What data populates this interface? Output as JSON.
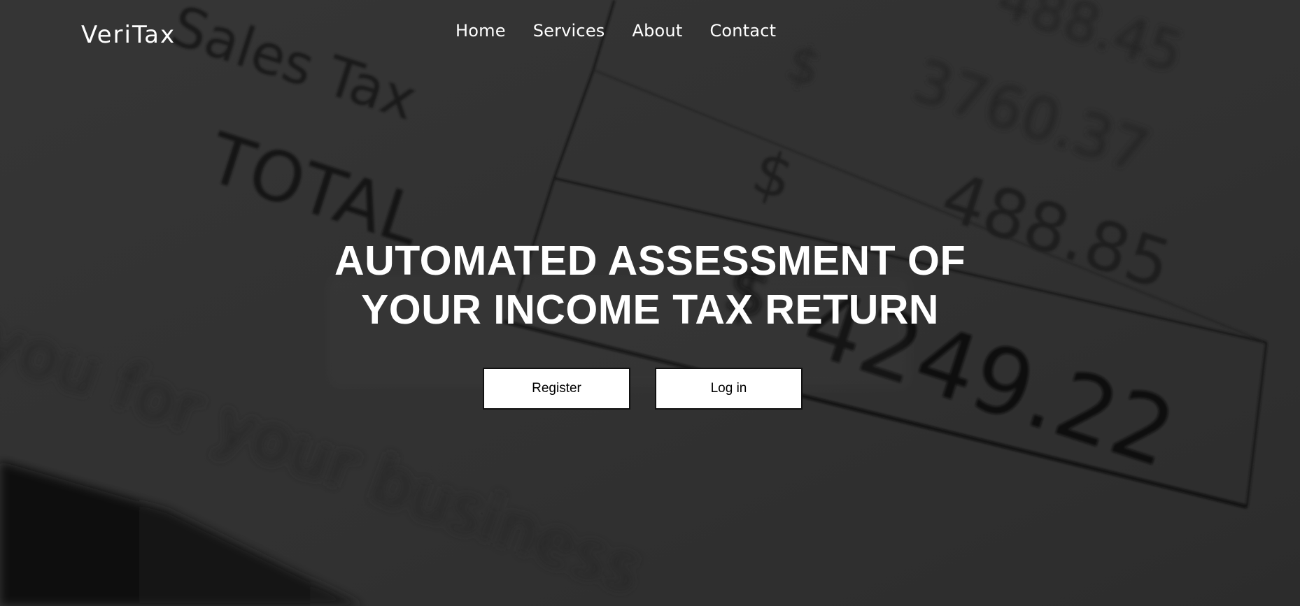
{
  "brand": {
    "name": "VeriTax"
  },
  "nav": {
    "items": [
      {
        "label": "Home"
      },
      {
        "label": "Services"
      },
      {
        "label": "About"
      },
      {
        "label": "Contact"
      }
    ]
  },
  "hero": {
    "title_line1": "AUTOMATED ASSESSMENT OF",
    "title_line2": "YOUR INCOME TAX RETURN"
  },
  "actions": {
    "register_label": "Register",
    "login_label": "Log in"
  },
  "background": {
    "texts": {
      "sales_tax": "Sales Tax",
      "total": "TOTAL",
      "dollar_1": "$",
      "dollar_2": "$",
      "dollar_3": "$",
      "amount_1": "488.45",
      "amount_2": "3760.37",
      "amount_3": "488.85",
      "amount_total": "4249.22",
      "footer_phrase": "you for your business"
    }
  },
  "colors": {
    "text_light": "#ffffff",
    "button_bg": "#ffffff",
    "button_border": "#111111"
  }
}
